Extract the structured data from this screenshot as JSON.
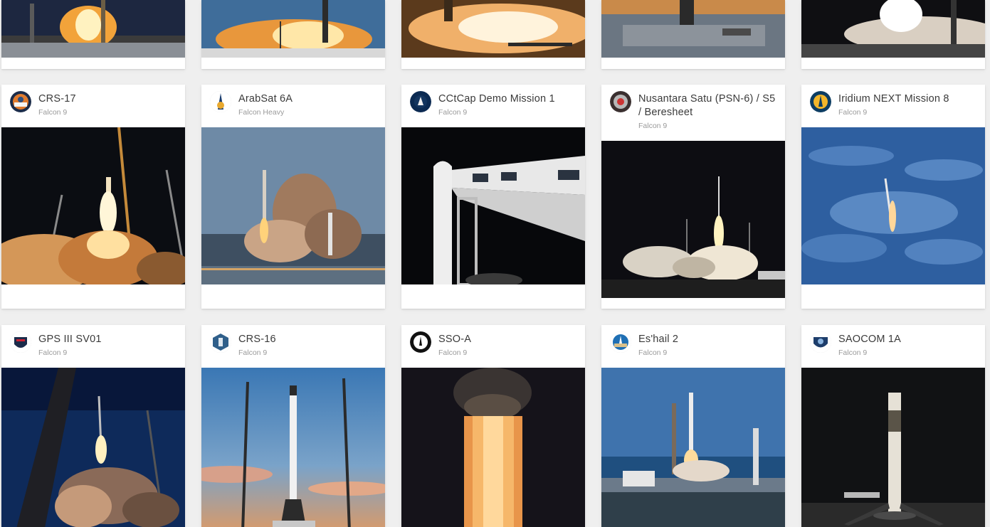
{
  "launches_row_2": [
    {
      "mission": "CRS-17",
      "rocket": "Falcon 9",
      "patch_icon": "crs-17-patch-icon",
      "accent": "#e07b2e"
    },
    {
      "mission": "ArabSat 6A",
      "rocket": "Falcon Heavy",
      "patch_icon": "arabsat-6a-patch-icon",
      "accent": "#1a3c6e"
    },
    {
      "mission": "CCtCap Demo Mission 1",
      "rocket": "Falcon 9",
      "patch_icon": "cctcap-demo-1-patch-icon",
      "accent": "#0b2a52"
    },
    {
      "mission": "Nusantara Satu (PSN-6) / S5 / Beresheet",
      "rocket": "Falcon 9",
      "patch_icon": "nusantara-satu-patch-icon",
      "accent": "#3a2f2f"
    },
    {
      "mission": "Iridium NEXT Mission 8",
      "rocket": "Falcon 9",
      "patch_icon": "iridium-next-8-patch-icon",
      "accent": "#0c3d63"
    }
  ],
  "launches_row_3": [
    {
      "mission": "GPS III SV01",
      "rocket": "Falcon 9",
      "patch_icon": "gps-iii-sv01-patch-icon",
      "accent": "#1b2b4a"
    },
    {
      "mission": "CRS-16",
      "rocket": "Falcon 9",
      "patch_icon": "crs-16-patch-icon",
      "accent": "#2f5f8a"
    },
    {
      "mission": "SSO-A",
      "rocket": "Falcon 9",
      "patch_icon": "sso-a-patch-icon",
      "accent": "#111111"
    },
    {
      "mission": "Es'hail 2",
      "rocket": "Falcon 9",
      "patch_icon": "eshail-2-patch-icon",
      "accent": "#1f6fb4"
    },
    {
      "mission": "SAOCOM 1A",
      "rocket": "Falcon 9",
      "patch_icon": "saocom-1a-patch-icon",
      "accent": "#1d3d6b"
    }
  ]
}
